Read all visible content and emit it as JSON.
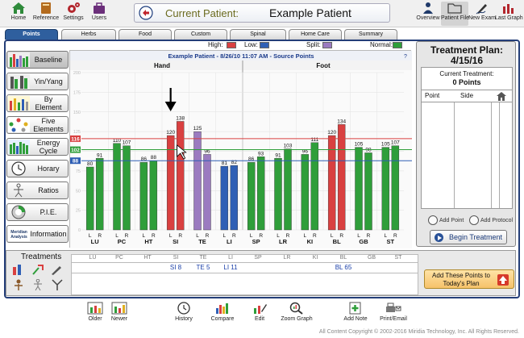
{
  "toolbar": {
    "home": "Home",
    "reference": "Reference",
    "settings": "Settings",
    "users": "Users",
    "overview": "Overview",
    "patient_file": "Patient File",
    "new_exam": "New Exam",
    "last_graph": "Last Graph"
  },
  "patient": {
    "label": "Current Patient:",
    "name": "Example Patient"
  },
  "tabs": [
    "Points",
    "Herbs",
    "Food",
    "Custom",
    "Spinal",
    "Home Care",
    "Summary"
  ],
  "left_buttons": [
    "Baseline",
    "Yin/Yang",
    "By Element",
    "Five Elements",
    "Energy Cycle",
    "Horary",
    "Ratios",
    "P.I.E.",
    "Information"
  ],
  "meridian_analysis_logo": "Meridian Analysis",
  "legend": [
    {
      "label": "High:",
      "color": "#d94040"
    },
    {
      "label": "Low:",
      "color": "#2f5fb5"
    },
    {
      "label": "Split:",
      "color": "#9b7bc0"
    },
    {
      "label": "Normal:",
      "color": "#2f9e3a"
    }
  ],
  "chart_data": {
    "type": "bar",
    "title": "Example Patient - 8/26/10 11:07 AM - Source Points",
    "help": "?",
    "sections": [
      "Hand",
      "Foot"
    ],
    "categories": [
      "LU",
      "PC",
      "HT",
      "SI",
      "TE",
      "LI",
      "SP",
      "LR",
      "KI",
      "BL",
      "GB",
      "ST"
    ],
    "sublabels": [
      "L",
      "R"
    ],
    "series": [
      {
        "name": "L",
        "values": [
          80,
          110,
          86,
          120,
          125,
          81,
          86,
          91,
          96,
          120,
          105,
          105
        ]
      },
      {
        "name": "R",
        "values": [
          91,
          107,
          88,
          138,
          96,
          82,
          93,
          103,
          111,
          134,
          98,
          107
        ]
      }
    ],
    "bar_colors": [
      [
        "#2f9e3a",
        "#2f9e3a"
      ],
      [
        "#2f9e3a",
        "#2f9e3a"
      ],
      [
        "#2f9e3a",
        "#2f9e3a"
      ],
      [
        "#d94040",
        "#d94040"
      ],
      [
        "#9b7bc0",
        "#9b7bc0"
      ],
      [
        "#2f5fb5",
        "#2f5fb5"
      ],
      [
        "#2f9e3a",
        "#2f9e3a"
      ],
      [
        "#2f9e3a",
        "#2f9e3a"
      ],
      [
        "#2f9e3a",
        "#2f9e3a"
      ],
      [
        "#d94040",
        "#d94040"
      ],
      [
        "#2f9e3a",
        "#2f9e3a"
      ],
      [
        "#2f9e3a",
        "#2f9e3a"
      ]
    ],
    "ylim": [
      0,
      200
    ],
    "yticks": [
      0,
      25,
      50,
      75,
      100,
      125,
      150,
      175,
      200
    ],
    "reference_lines": [
      {
        "value": 116,
        "label": "116",
        "color": "#d94040"
      },
      {
        "value": 102,
        "label": "102",
        "color": "#2f9e3a"
      },
      {
        "value": 88,
        "label": "88",
        "color": "#2f5fb5"
      }
    ],
    "grid": true
  },
  "treatment_plan": {
    "title": "Treatment Plan:",
    "date": "4/15/16",
    "current_label": "Current Treatment:",
    "points": "0 Points",
    "col_point": "Point",
    "col_side": "Side",
    "add_point": "Add Point",
    "add_protocol": "Add Protocol",
    "begin": "Begin Treatment"
  },
  "treatments": {
    "title": "Treatments",
    "codes": [
      "LU",
      "PC",
      "HT",
      "SI",
      "TE",
      "LI",
      "SP",
      "LR",
      "KI",
      "BL",
      "GB",
      "ST"
    ],
    "values": [
      "",
      "",
      "",
      "SI 8",
      "TE 5",
      "LI 11",
      "",
      "",
      "",
      "BL 65",
      "",
      ""
    ],
    "add_button": "Add These Points to Today's Plan"
  },
  "bottom": {
    "older": "Older",
    "newer": "Newer",
    "history": "History",
    "compare": "Compare",
    "edit": "Edit",
    "zoom": "Zoom Graph",
    "add_note": "Add Note",
    "print": "Print/Email"
  },
  "copyright": "All Content Copyright © 2002-2016 Miridia Technology, Inc. All Rights Reserved."
}
